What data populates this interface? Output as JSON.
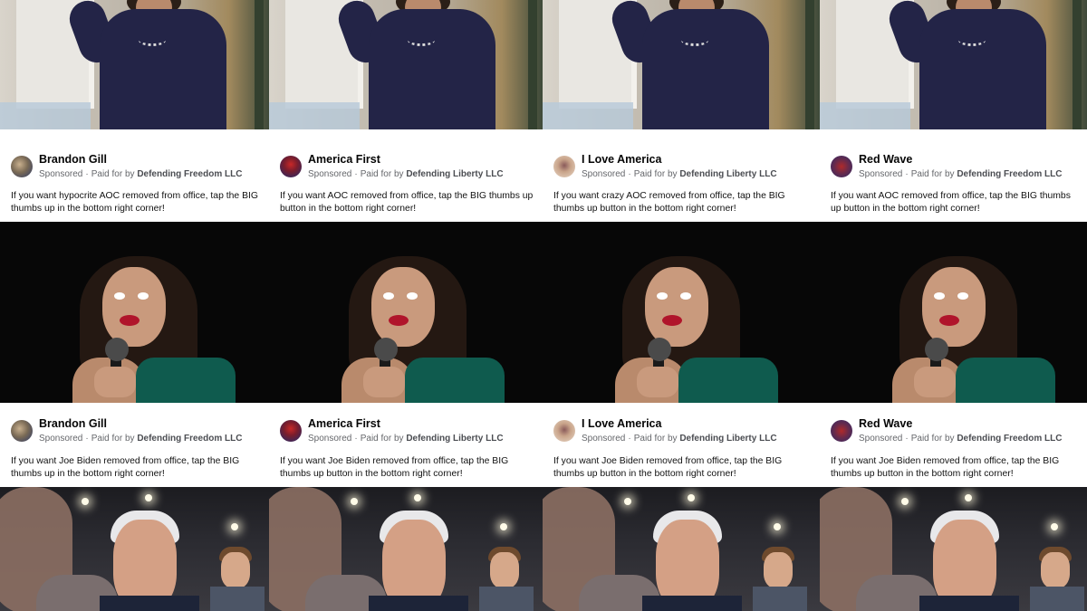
{
  "ads": [
    {
      "top": {
        "page_name": "Brandon Gill",
        "sponsored": "Sponsored",
        "paid_prefix": "Paid for by",
        "payer": "Defending Freedom LLC",
        "text": "If you want hypocrite AOC removed from office, tap the BIG thumbs up in the bottom right corner!"
      },
      "bottom": {
        "page_name": "Brandon Gill",
        "sponsored": "Sponsored",
        "paid_prefix": "Paid for by",
        "payer": "Defending Freedom LLC",
        "text": "If you want Joe Biden removed from office, tap the BIG thumbs up in the bottom right corner!"
      }
    },
    {
      "top": {
        "page_name": "America First",
        "sponsored": "Sponsored",
        "paid_prefix": "Paid for by",
        "payer": "Defending Liberty LLC",
        "text": "If you want AOC removed from office, tap the BIG thumbs up button in the bottom right corner!"
      },
      "bottom": {
        "page_name": "America First",
        "sponsored": "Sponsored",
        "paid_prefix": "Paid for by",
        "payer": "Defending Liberty LLC",
        "text": "If you want Joe Biden removed from office, tap the BIG thumbs up button in the bottom right corner!"
      }
    },
    {
      "top": {
        "page_name": "I Love America",
        "sponsored": "Sponsored",
        "paid_prefix": "Paid for by",
        "payer": "Defending Liberty LLC",
        "text": "If you want crazy AOC removed from office, tap the BIG thumbs up button in the bottom right corner!"
      },
      "bottom": {
        "page_name": "I Love America",
        "sponsored": "Sponsored",
        "paid_prefix": "Paid for by",
        "payer": "Defending Liberty LLC",
        "text": "If you want Joe Biden removed from office, tap the BIG thumbs up button in the bottom right corner!"
      }
    },
    {
      "top": {
        "page_name": "Red Wave",
        "sponsored": "Sponsored",
        "paid_prefix": "Paid for by",
        "payer": "Defending Freedom LLC",
        "text": "If you want AOC removed from office, tap the BIG thumbs up button in the bottom right corner!"
      },
      "bottom": {
        "page_name": "Red Wave",
        "sponsored": "Sponsored",
        "paid_prefix": "Paid for by",
        "payer": "Defending Freedom LLC",
        "text": "If you want Joe Biden removed from office, tap the BIG thumbs up button in the bottom right corner!"
      }
    }
  ],
  "colors": {
    "page_name": "#050505",
    "meta": "#65676b",
    "dark_photo": "#070707"
  }
}
